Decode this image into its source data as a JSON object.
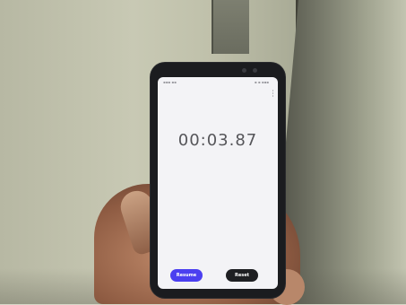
{
  "scene": {
    "subject": "photo of a hand holding a smartphone showing a stopwatch app"
  },
  "phone_screen": {
    "timer_display": "00:03.87",
    "buttons": {
      "resume_label": "Resume",
      "reset_label": "Reset"
    },
    "colors": {
      "resume_button": "#4b3ff0",
      "reset_button": "#1e1f22"
    }
  }
}
